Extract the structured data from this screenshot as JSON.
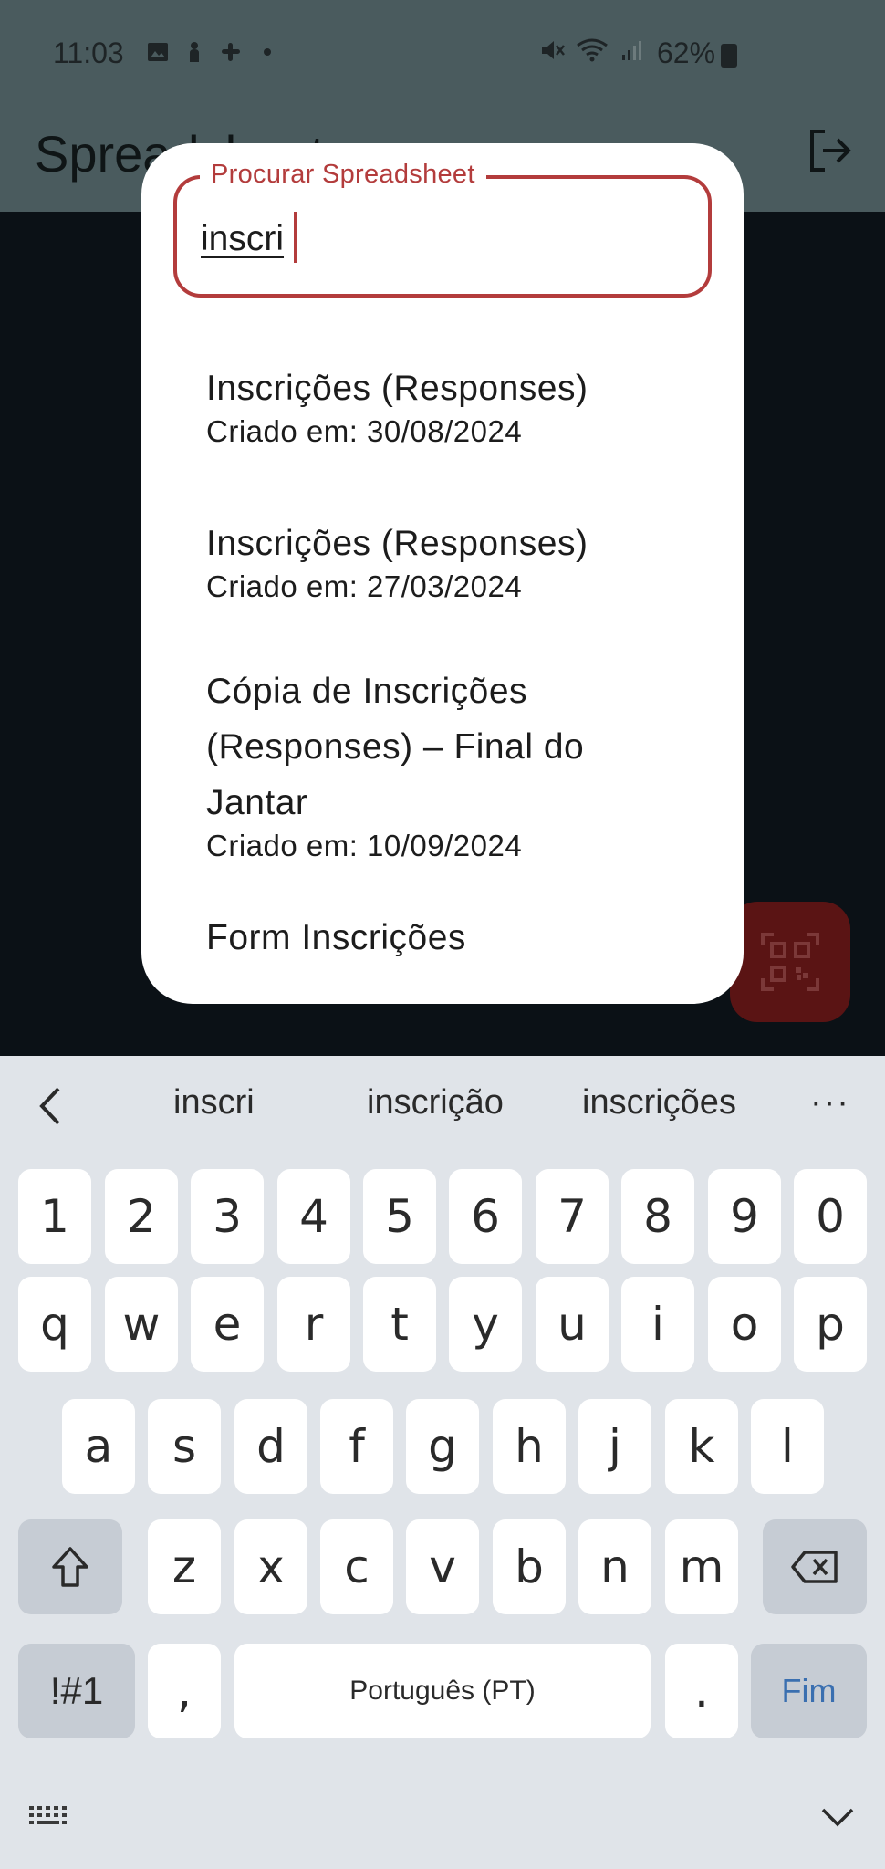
{
  "status_bar": {
    "time": "11:03",
    "battery": "62%",
    "icons_left": [
      "image-icon",
      "person-icon",
      "slack-icon",
      "dot-icon"
    ],
    "icons_right": [
      "mute-icon",
      "wifi-icon",
      "signal-icon",
      "battery-icon"
    ]
  },
  "app_bar": {
    "title": "Spreadsheets"
  },
  "dialog": {
    "search": {
      "label": "Procurar Spreadsheet",
      "value": "inscri"
    },
    "results": [
      {
        "title": "Inscrições (Responses)",
        "date": "Criado em: 30/08/2024"
      },
      {
        "title": "Inscrições (Responses)",
        "date": "Criado em: 27/03/2024"
      },
      {
        "title": "Cópia de Inscrições (Responses) – Final do Jantar",
        "date": "Criado em: 10/09/2024"
      },
      {
        "title": "Form Inscrições",
        "date": ""
      }
    ]
  },
  "keyboard": {
    "suggestions": [
      "inscri",
      "inscrição",
      "inscrições"
    ],
    "more": "···",
    "row_numbers": [
      "1",
      "2",
      "3",
      "4",
      "5",
      "6",
      "7",
      "8",
      "9",
      "0"
    ],
    "row1": [
      "q",
      "w",
      "e",
      "r",
      "t",
      "y",
      "u",
      "i",
      "o",
      "p"
    ],
    "row2": [
      "a",
      "s",
      "d",
      "f",
      "g",
      "h",
      "j",
      "k",
      "l"
    ],
    "row3": [
      "z",
      "x",
      "c",
      "v",
      "b",
      "n",
      "m"
    ],
    "symbols_key": "!#1",
    "comma_key": ",",
    "space_label": "Português (PT)",
    "period_key": ".",
    "done_label": "Fim"
  },
  "colors": {
    "accent": "#b33c3c",
    "appbar": "#4a5b5e",
    "fab": "#5a1414",
    "keyboard_bg": "#e0e4e9",
    "done_text": "#3a6fb0"
  }
}
